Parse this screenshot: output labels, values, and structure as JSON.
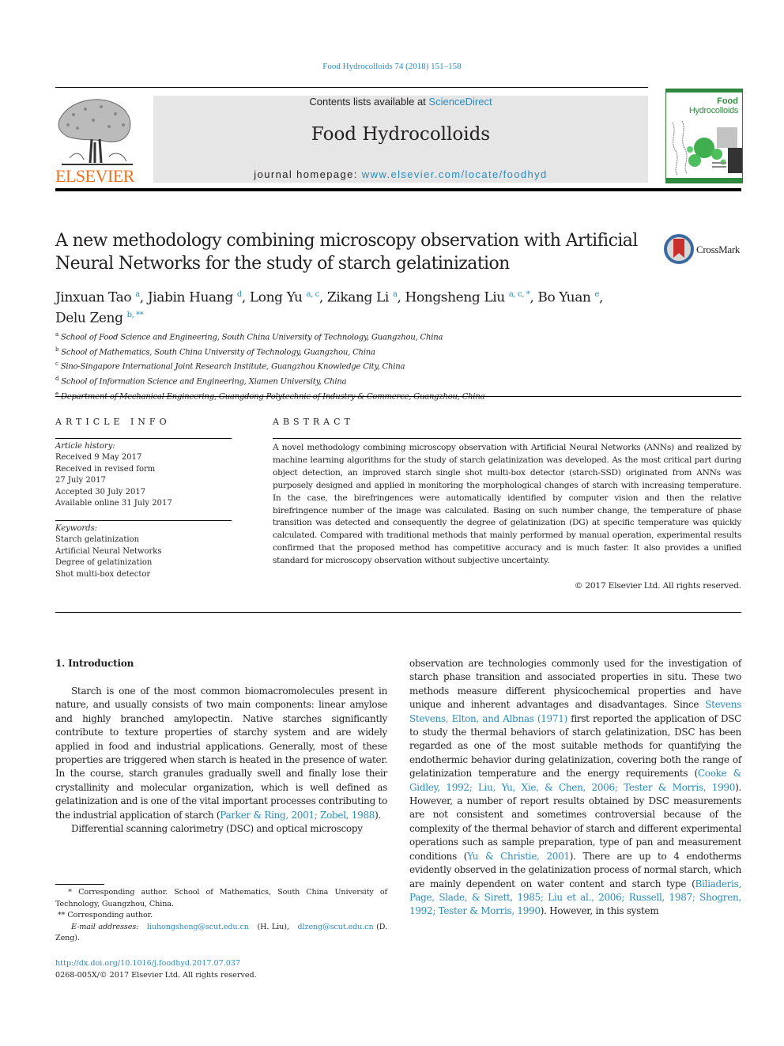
{
  "header": {
    "citation": "Food Hydrocolloids 74 (2018) 151–158",
    "contents_prefix": "Contents lists available at ",
    "contents_link": "ScienceDirect",
    "journal_name": "Food Hydrocolloids",
    "homepage_prefix": "journal homepage: ",
    "homepage_link": "www.elsevier.com/locate/foodhyd",
    "publisher_logo_text": "ELSEVIER",
    "cover_title_line1": "Food",
    "cover_title_line2": "Hydrocolloids",
    "crossmark_label": "CrossMark"
  },
  "colors": {
    "link": "#2a8bbf",
    "elsevier_orange": "#e9711c",
    "cover_green": "#2e8b3e",
    "banner_gray": "#e6e6e6"
  },
  "article": {
    "title": "A new methodology combining microscopy observation with Artificial Neural Networks for the study of starch gelatinization",
    "authors": [
      {
        "name": "Jinxuan Tao",
        "sup": "a",
        "sep": ", "
      },
      {
        "name": "Jiabin Huang",
        "sup": "d",
        "sep": ", "
      },
      {
        "name": "Long Yu",
        "sup": "a, c",
        "sep": ", "
      },
      {
        "name": "Zikang Li",
        "sup": "a",
        "sep": ", "
      },
      {
        "name": "Hongsheng Liu",
        "sup": "a, c, *",
        "sep": ", "
      },
      {
        "name": "Bo Yuan",
        "sup": "e",
        "sep": ","
      },
      {
        "name": "Delu Zeng",
        "sup": "b, **",
        "sep": ""
      }
    ],
    "affiliations": [
      {
        "key": "a",
        "text": "School of Food Science and Engineering, South China University of Technology, Guangzhou, China"
      },
      {
        "key": "b",
        "text": "School of Mathematics, South China University of Technology, Guangzhou, China"
      },
      {
        "key": "c",
        "text": "Sino-Singapore International Joint Research Institute, Guangzhou Knowledge City, China"
      },
      {
        "key": "d",
        "text": "School of Information Science and Engineering, Xiamen University, China"
      },
      {
        "key": "e",
        "text": "Department of Mechanical Engineering, Guangdong Polytechnic of Industry & Commerce, Guangzhou, China"
      }
    ]
  },
  "article_info": {
    "heading": "ARTICLE INFO",
    "history_label": "Article history:",
    "history": [
      "Received 9 May 2017",
      "Received in revised form",
      "27 July 2017",
      "Accepted 30 July 2017",
      "Available online 31 July 2017"
    ],
    "keywords_label": "Keywords:",
    "keywords": [
      "Starch gelatinization",
      "Artificial Neural Networks",
      "Degree of gelatinization",
      "Shot multi-box detector"
    ]
  },
  "abstract": {
    "heading": "ABSTRACT",
    "text": "A novel methodology combining microscopy observation with Artificial Neural Networks (ANNs) and realized by machine learning algorithms for the study of starch gelatinization was developed. As the most critical part during object detection, an improved starch single shot multi-box detector (starch-SSD) originated from ANNs was purposely designed and applied in monitoring the morphological changes of starch with increasing temperature. In the case, the birefringences were automatically identified by computer vision and then the relative birefringence number of the image was calculated. Basing on such number change, the temperature of phase transition was detected and consequently the degree of gelatinization (DG) at specific temperature was quickly calculated. Compared with traditional methods that mainly performed by manual operation, experimental results confirmed that the proposed method has competitive accuracy and is much faster. It also provides a unified standard for microscopy obser­vation without subjective uncertainty.",
    "copyright": "© 2017 Elsevier Ltd. All rights reserved."
  },
  "body": {
    "section_heading": "1.  Introduction",
    "left_para1": [
      {
        "t": "Starch is one of the most common biomacromolecules present in nature, and usually consists of two main components: linear amylose and highly branched amylopectin. Native starches signif­icantly contribute to texture properties of starchy system and are widely applied in food and industrial applications. Generally, most of these properties are triggered when starch is heated in the presence of water. In the course, starch granules gradually swell and finally lose their crystallinity and molecular organization, which is well defined as gelatinization and is one of the vital important processes contributing to the industrial application of starch ("
      },
      {
        "link": "Parker & Ring, 2001; Zobel, 1988"
      },
      {
        "t": ")."
      }
    ],
    "left_para2": "Differential scanning calorimetry (DSC) and optical microscopy",
    "right_para": [
      {
        "t": "observation are technologies commonly used for the investigation of starch phase transition and associated properties in situ. These two methods measure different physicochemical properties and have unique and inherent advantages and disadvantages. Since "
      },
      {
        "link": "Stevens Stevens, Elton, and Albnas (1971)"
      },
      {
        "t": " first reported the appli­cation of DSC to study the thermal behaviors of starch gelatiniza­tion, DSC has been regarded as one of the most suitable methods for quantifying the endothermic behavior during gelatinization, covering both the range of gelatinization temperature and the en­ergy requirements ("
      },
      {
        "link": "Cooke & Gidley, 1992; Liu, Yu, Xie, & Chen, 2006; Tester & Morris, 1990"
      },
      {
        "t": "). However, a number of report re­sults obtained by DSC measurements are not consistent and sometimes controversial because of the complexity of the thermal behavior of starch and different experimental operations such as sample preparation, type of pan and measurement conditions ("
      },
      {
        "link": "Yu & Christie, 2001"
      },
      {
        "t": "). There are up to 4 endotherms evidently observed in the gelatinization process of normal starch, which are mainly dependent on water content and starch type ("
      },
      {
        "link": "Biliaderis, Page, Slade, & Sirett, 1985; Liu et al., 2006; Russell, 1987; Shogren, 1992; Tester & Morris, 1990"
      },
      {
        "t": "). However, in this system"
      }
    ]
  },
  "footnotes": {
    "fn1_mark": "*",
    "fn1_text": "Corresponding author. School of Mathematics, South China University of Technology, Guangzhou, China.",
    "fn2_mark": "**",
    "fn2_text": "Corresponding author.",
    "email_label": "E-mail addresses:",
    "email1": "liuhongsheng@scut.edu.cn",
    "email1_owner": "(H. Liu),",
    "email2": "dlzeng@scut.edu.cn",
    "email2_owner": "(D. Zeng).",
    "doi": "http://dx.doi.org/10.1016/j.foodhyd.2017.07.037",
    "issn_copyright": "0268-005X/© 2017 Elsevier Ltd. All rights reserved."
  }
}
